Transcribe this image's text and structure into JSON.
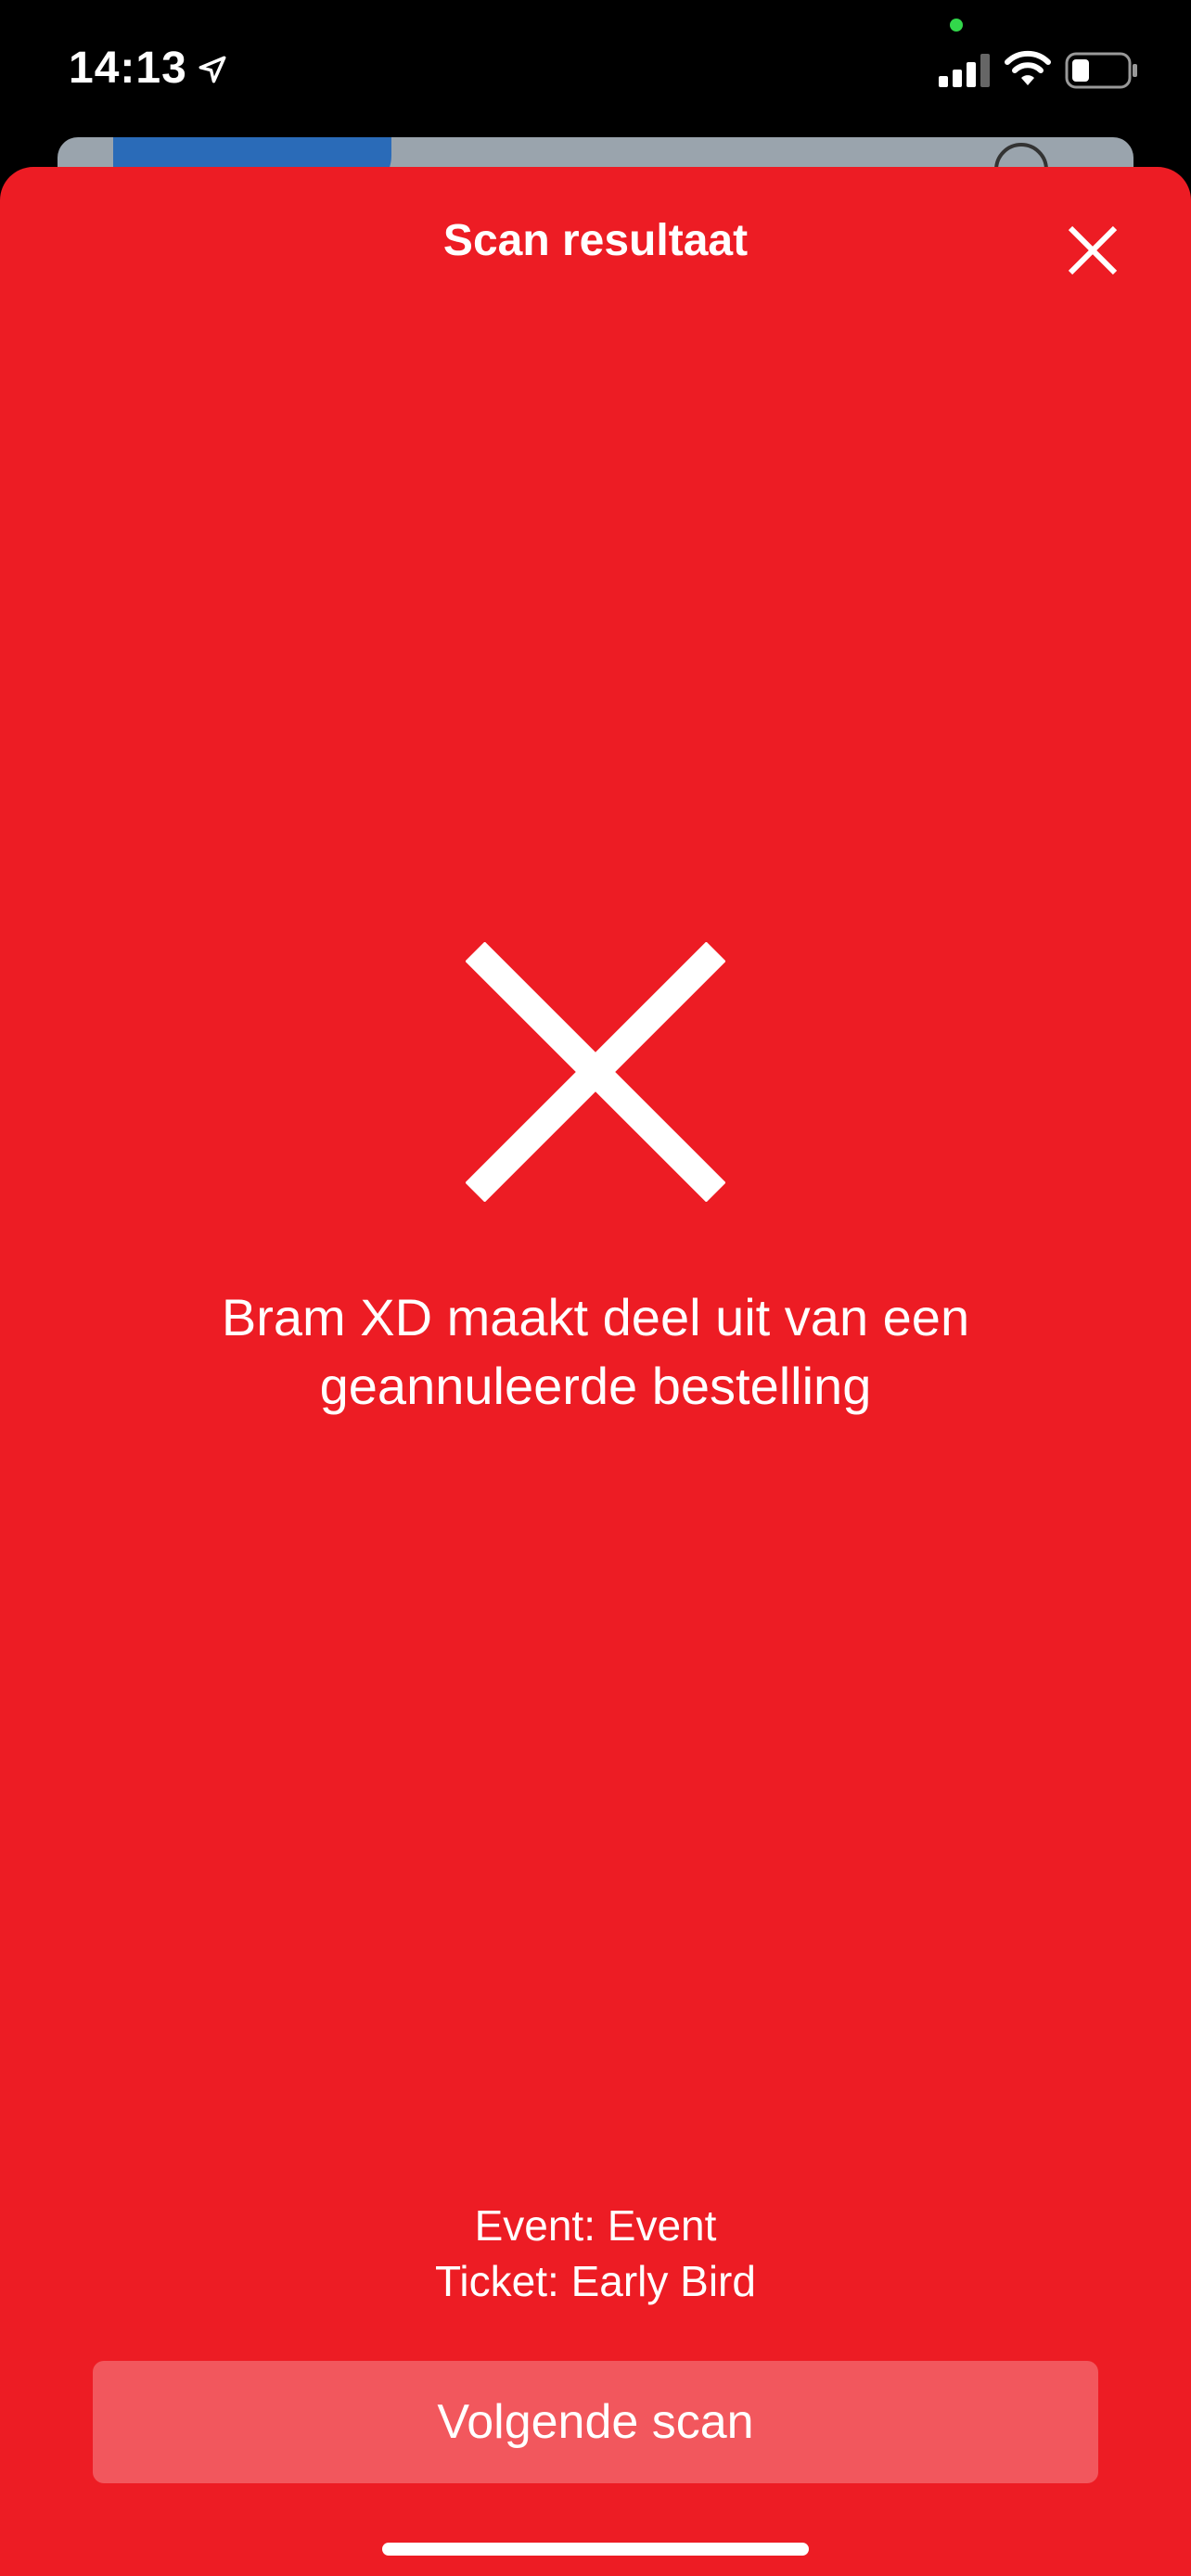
{
  "status_bar": {
    "time": "14:13",
    "icons": [
      "location-arrow-icon",
      "signal-icon",
      "wifi-icon",
      "battery-icon"
    ]
  },
  "sheet": {
    "title": "Scan resultaat",
    "close_icon": "close-icon",
    "result_icon": "cross-icon",
    "message": "Bram XD maakt deel uit van een geannuleerde bestelling",
    "details": {
      "event": "Event: Event",
      "ticket": "Ticket: Early Bird"
    },
    "next_button_label": "Volgende scan"
  },
  "colors": {
    "sheet_background": "#ed1c24",
    "button_background": "#f2575d",
    "text": "#ffffff",
    "privacy_indicator": "#32d74b"
  }
}
